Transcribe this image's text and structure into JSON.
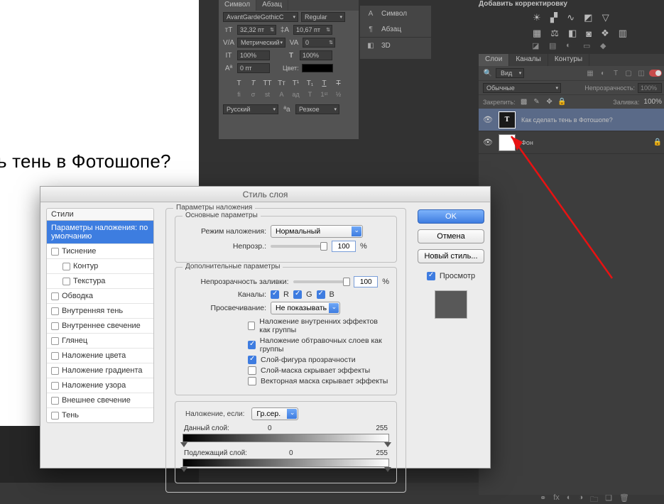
{
  "canvas_text": "ь тень в Фотошопе?",
  "char_panel": {
    "tabs": {
      "symbol": "Символ",
      "paragraph": "Абзац"
    },
    "font": "AvantGardeGothicC",
    "style": "Regular",
    "size": "32,32 пт",
    "leading": "10,67 пт",
    "kerning": "Метрический",
    "tracking": "0",
    "vscale": "100%",
    "hscale": "100%",
    "baseline": "0 пт",
    "color_label": "Цвет:",
    "lang": "Русский",
    "aa": "Резкое"
  },
  "aux_panel": {
    "symbol": "Символ",
    "paragraph": "Абзац",
    "threed": "3D"
  },
  "adjustments": {
    "title": "Добавить корректировку"
  },
  "layers": {
    "tabs": {
      "layers": "Слои",
      "channels": "Каналы",
      "paths": "Контуры"
    },
    "filter": "Вид",
    "blend_mode": "Обычные",
    "opacity_label": "Непрозрачность:",
    "opacity": "100%",
    "lock_label": "Закрепить:",
    "fill_label": "Заливка:",
    "fill": "100%",
    "rows": [
      {
        "name": "Как сделать тень в Фотошопе?",
        "type": "T"
      },
      {
        "name": "Фон",
        "type": "bg"
      }
    ]
  },
  "dialog": {
    "title": "Стиль слоя",
    "left_header": "Стили",
    "left_selected": "Параметры наложения: по умолчанию",
    "styles": [
      "Тиснение",
      "Контур",
      "Текстура",
      "Обводка",
      "Внутренняя тень",
      "Внутреннее свечение",
      "Глянец",
      "Наложение цвета",
      "Наложение градиента",
      "Наложение узора",
      "Внешнее свечение",
      "Тень"
    ],
    "fs_blend": "Параметры наложения",
    "fs_basic": "Основные параметры",
    "blend_mode_label": "Режим наложения:",
    "blend_mode": "Нормальный",
    "opacity_label": "Непрозр.:",
    "opacity": "100",
    "fs_adv": "Дополнительные параметры",
    "fill_label": "Непрозрачность заливки:",
    "fill": "100",
    "channels_label": "Каналы:",
    "ch_r": "R",
    "ch_g": "G",
    "ch_b": "B",
    "knockout_label": "Просвечивание:",
    "knockout": "Не показывать",
    "chk1": "Наложение внутренних эффектов как группы",
    "chk2": "Наложение обтравочных слоев как группы",
    "chk3": "Слой-фигура прозрачности",
    "chk4": "Слой-маска скрывает эффекты",
    "chk5": "Векторная маска скрывает эффекты",
    "fs_blendif": "Наложение, если:",
    "blendif": "Гр.сер.",
    "this_layer": "Данный слой:",
    "this_a": "0",
    "this_b": "255",
    "under_layer": "Подлежащий слой:",
    "under_a": "0",
    "under_b": "255",
    "ok": "OK",
    "cancel": "Отмена",
    "newstyle": "Новый стиль...",
    "preview": "Просмотр",
    "pct": "%"
  }
}
